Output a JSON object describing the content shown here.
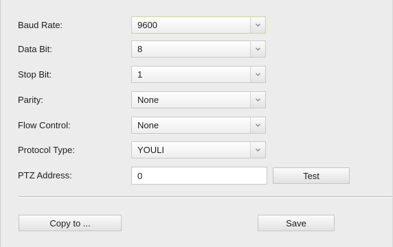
{
  "form": {
    "baud_rate": {
      "label": "Baud Rate:",
      "value": "9600"
    },
    "data_bit": {
      "label": "Data Bit:",
      "value": "8"
    },
    "stop_bit": {
      "label": "Stop Bit:",
      "value": "1"
    },
    "parity": {
      "label": "Parity:",
      "value": "None"
    },
    "flow_control": {
      "label": "Flow Control:",
      "value": "None"
    },
    "protocol_type": {
      "label": "Protocol Type:",
      "value": "YOULI"
    },
    "ptz_address": {
      "label": "PTZ Address:",
      "value": "0"
    }
  },
  "buttons": {
    "test": "Test",
    "copy_to": "Copy to ...",
    "save": "Save"
  },
  "icons": {
    "dropdown": "chevron-down-icon"
  },
  "colors": {
    "background": "#ececec",
    "focused_select_border": "#cfd68a"
  }
}
